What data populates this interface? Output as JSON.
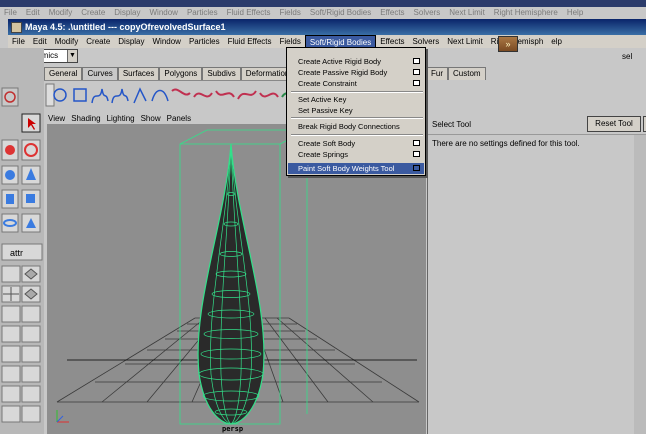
{
  "ghost_menu": [
    "File",
    "Edit",
    "Modify",
    "Create",
    "Display",
    "Window",
    "Particles",
    "Fluid Effects",
    "Fields",
    "Soft/Rigid Bodies",
    "Effects",
    "Solvers",
    "Next Limit",
    "Right Hemisphere",
    "Help"
  ],
  "window_title": "Maya 4.5: .\\untitled   ---   copyOfrevolvedSurface1",
  "menubar": [
    "File",
    "Edit",
    "Modify",
    "Create",
    "Display",
    "Window",
    "Particles",
    "Fluid Effects",
    "Fields",
    "Soft/Rigid Bodies",
    "Effects",
    "Solvers",
    "Next Limit",
    "Right Hemisph",
    "elp"
  ],
  "menu_active": "Soft/Rigid Bodies",
  "mode_select": "Dynamics",
  "shelf_tabs": [
    "General",
    "Curves",
    "Surfaces",
    "Polygons",
    "Subdivs",
    "Deformation",
    "Animatio"
  ],
  "shelf_tabs_right": [
    "Fur",
    "Custom"
  ],
  "active_shelf_tab": "Curves",
  "viewport_menu": [
    "View",
    "Shading",
    "Lighting",
    "Show",
    "Panels"
  ],
  "viewport_label": "persp",
  "sel_label": "sel",
  "dropdown": {
    "items": [
      {
        "label": "Create Active Rigid Body",
        "option": true
      },
      {
        "label": "Create Passive Rigid Body",
        "option": true
      },
      {
        "label": "Create Constraint",
        "option": true
      },
      {
        "label": "Set Active Key",
        "option": false
      },
      {
        "label": "Set Passive Key",
        "option": false
      },
      {
        "label": "Break Rigid Body Connections",
        "option": false
      },
      {
        "label": "Create Soft Body",
        "option": true
      },
      {
        "label": "Create Springs",
        "option": true
      },
      {
        "label": "Paint Soft Body Weights Tool",
        "option": true
      }
    ]
  },
  "tool_settings": {
    "title": "Select Tool",
    "reset_label": "Reset Tool",
    "message": "There are no settings defined for this tool."
  },
  "colors": {
    "title_bar": "#0a246a",
    "menu_highlight": "#3b5aa0",
    "wireframe": "#33e08a",
    "viewport_bg": "#8e8e8e"
  }
}
